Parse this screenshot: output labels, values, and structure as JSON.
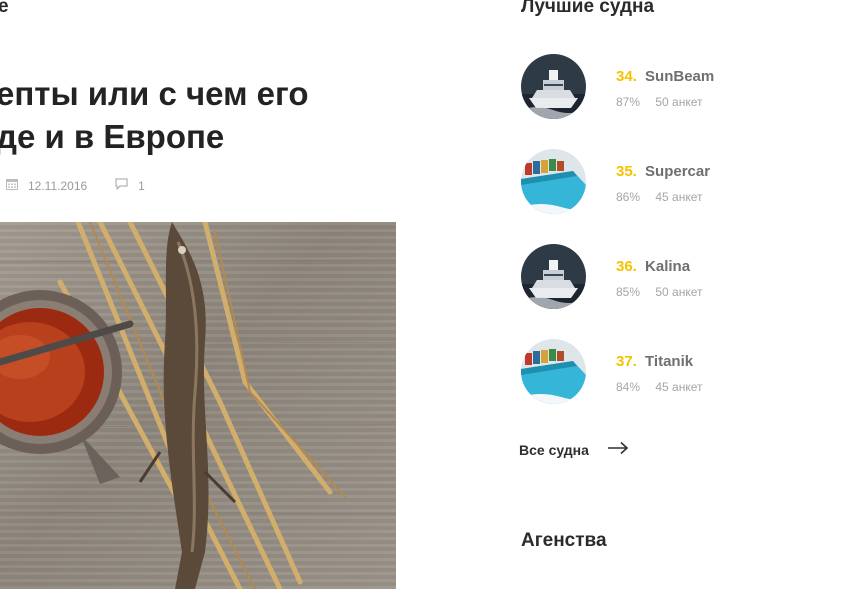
{
  "article": {
    "section_label": "е",
    "title_line1": "епты или с чем его",
    "title_line2": "де и в Европе",
    "date": "12.11.2016",
    "comments_count": "1",
    "image_icon": "food-photo"
  },
  "sidebar": {
    "title": "Лучшие судна",
    "ships": [
      {
        "rank": "34.",
        "name": "SunBeam",
        "percent": "87%",
        "surveys": "50 анкет",
        "avatar": "superyacht-icon"
      },
      {
        "rank": "35.",
        "name": "Supercar",
        "percent": "86%",
        "surveys": "45 анкет",
        "avatar": "container-ship-icon"
      },
      {
        "rank": "36.",
        "name": "Kalina",
        "percent": "85%",
        "surveys": "50 анкет",
        "avatar": "superyacht-icon"
      },
      {
        "rank": "37.",
        "name": "Titanik",
        "percent": "84%",
        "surveys": "45 анкет",
        "avatar": "container-ship-icon"
      }
    ],
    "all_ships_label": "Все судна",
    "agencies_title": "Агенства"
  },
  "colors": {
    "rank_accent": "#f5c200",
    "ship_name": "#6f6f6f",
    "muted_text": "#a5a5a5",
    "heading": "#2b2b2b"
  }
}
